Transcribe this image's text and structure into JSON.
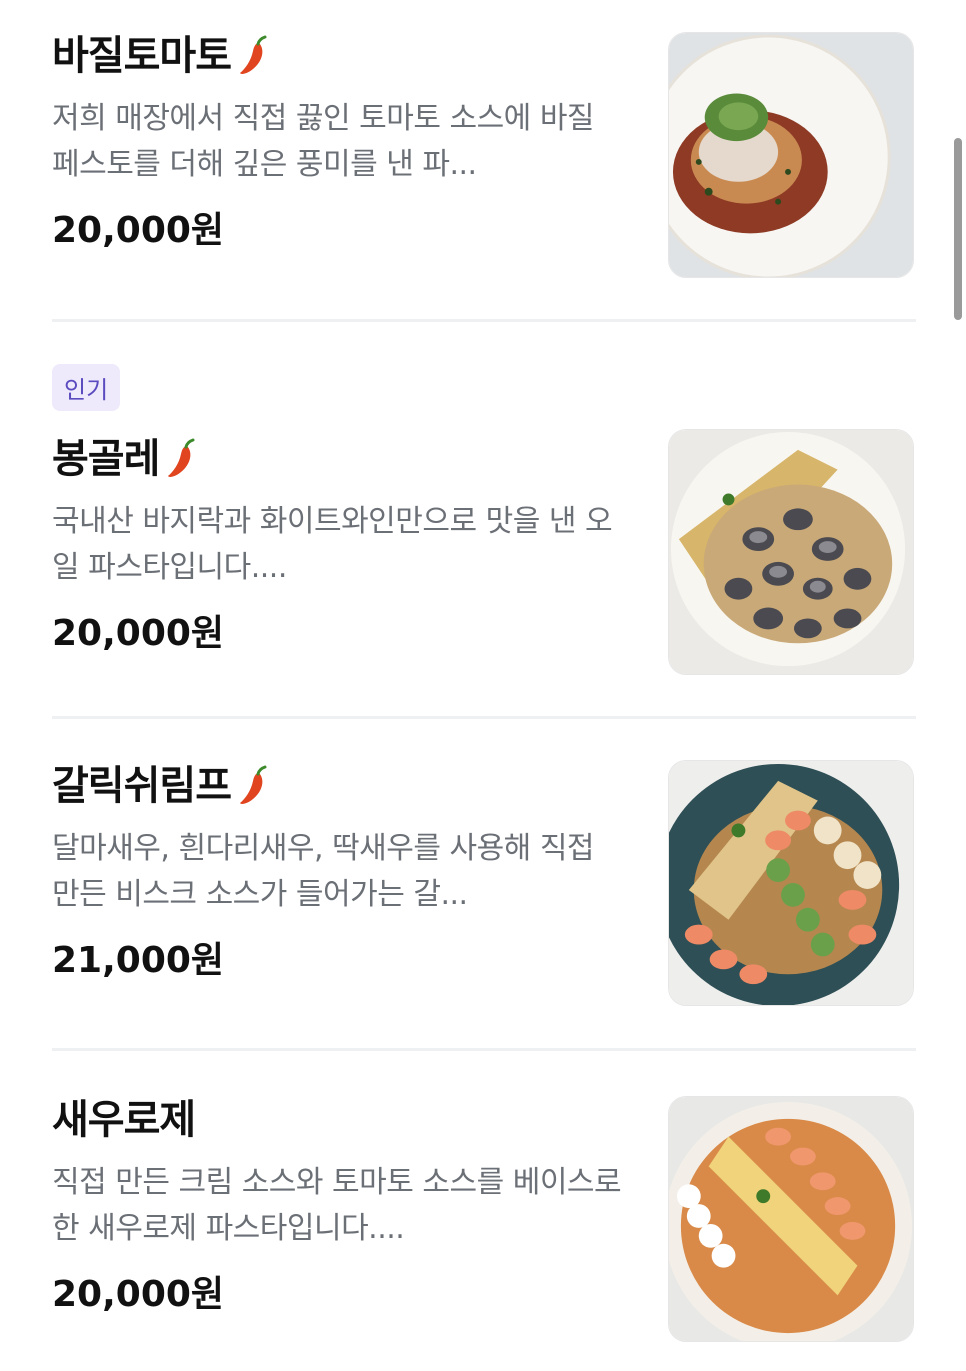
{
  "menu_items": [
    {
      "name": "바질토마토",
      "spicy": true,
      "badge": "",
      "description": "저희 매장에서 직접 끓인 토마토 소스에 바질 페스토를 더해 깊은 풍미를 낸 파...",
      "price": "20,000원",
      "image_icon": "basil-tomato-pasta-image"
    },
    {
      "name": "봉골레",
      "spicy": true,
      "badge": "인기",
      "description": "국내산 바지락과 화이트와인만으로 맛을 낸 오일 파스타입니다....",
      "price": "20,000원",
      "image_icon": "vongole-pasta-image"
    },
    {
      "name": "갈릭쉬림프",
      "spicy": true,
      "badge": "",
      "description": "달마새우, 흰다리새우, 딱새우를 사용해 직접 만든 비스크 소스가 들어가는 갈...",
      "price": "21,000원",
      "image_icon": "garlic-shrimp-pasta-image"
    },
    {
      "name": "새우로제",
      "spicy": false,
      "badge": "",
      "description": "직접 만든 크림 소스와 토마토 소스를 베이스로 한 새우로제 파스타입니다....",
      "price": "20,000원",
      "image_icon": "shrimp-rose-pasta-image"
    }
  ],
  "colors": {
    "badge_bg": "#eeeafc",
    "badge_text": "#5a4bbf",
    "description": "#6b6f76",
    "chili": "#e0451f"
  }
}
